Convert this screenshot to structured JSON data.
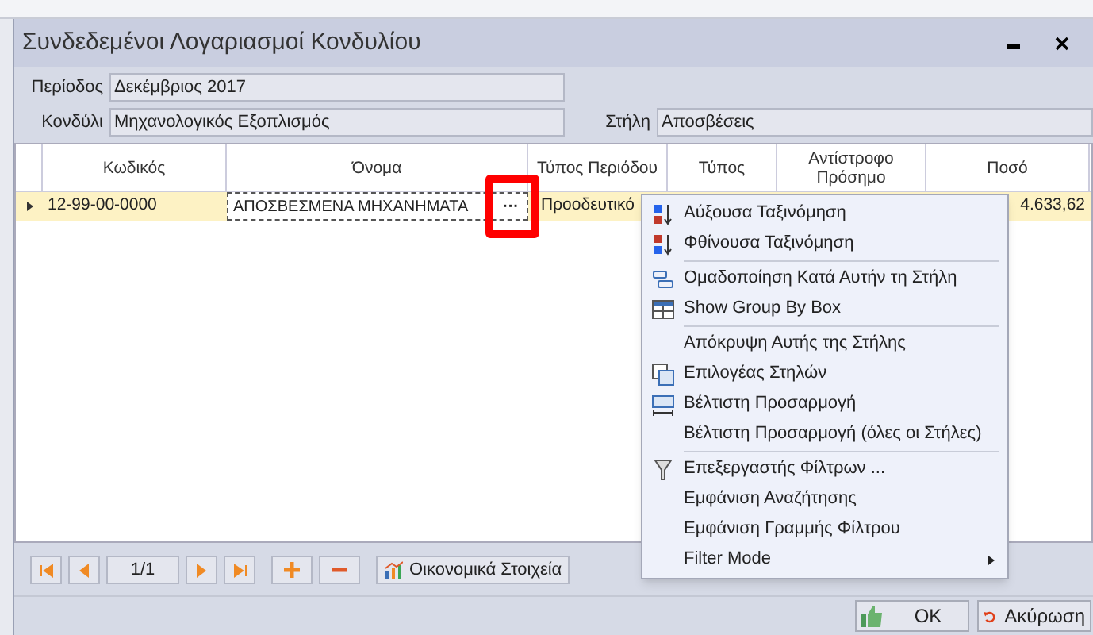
{
  "window": {
    "title": "Συνδεδεμένοι Λογαριασμοί Κονδυλίου"
  },
  "fields": [
    {
      "label": "Περίοδος",
      "value": "Δεκέμβριος 2017"
    },
    {
      "label": "Κονδύλι",
      "value": "Μηχανολογικός Εξοπλισμός"
    },
    {
      "label": "Στήλη",
      "value": "Αποσβέσεις"
    }
  ],
  "table": {
    "columns": [
      "Κωδικός",
      "Όνομα",
      "Τύπος Περιόδου",
      "Τύπος",
      "Αντίστροφο Πρόσημο",
      "Ποσό"
    ],
    "rows": [
      {
        "selected": true,
        "cells": [
          "12-99-00-0000",
          "ΑΠΟΣΒΕΣΜΕΝΑ ΜΗΧΑΝΗΜΑΤΑ",
          "Προοδευτικό",
          "",
          "",
          "4.633,62"
        ],
        "editor_button": "···"
      }
    ]
  },
  "context_menu": [
    {
      "label": "Αύξουσα Ταξινόμηση",
      "submenu": false
    },
    {
      "label": "Φθίνουσα Ταξινόμηση",
      "submenu": false
    },
    {
      "label": "Ομαδοποίηση Κατά Αυτήν τη Στήλη",
      "submenu": false
    },
    {
      "label": "Show Group By Box",
      "submenu": false
    },
    {
      "label": "Απόκρυψη Αυτής της Στήλης",
      "submenu": false
    },
    {
      "label": "Επιλογέας Στηλών",
      "submenu": false
    },
    {
      "label": "Βέλτιστη Προσαρμογή",
      "submenu": false
    },
    {
      "label": "Βέλτιστη Προσαρμογή (όλες οι Στήλες)",
      "submenu": false
    },
    {
      "label": "Επεξεργαστής Φίλτρων ...",
      "submenu": false
    },
    {
      "label": "Εμφάνιση Αναζήτησης",
      "submenu": false
    },
    {
      "label": "Εμφάνιση Γραμμής Φίλτρου",
      "submenu": false
    },
    {
      "label": "Filter Mode",
      "submenu": true
    }
  ],
  "navigator": {
    "page": "1/1"
  },
  "toolbar_button": "Οικονομικά Στοιχεία",
  "buttons": [
    {
      "label": "OK",
      "kind": "ok"
    },
    {
      "label": "Ακύρωση",
      "kind": "cancel"
    }
  ]
}
